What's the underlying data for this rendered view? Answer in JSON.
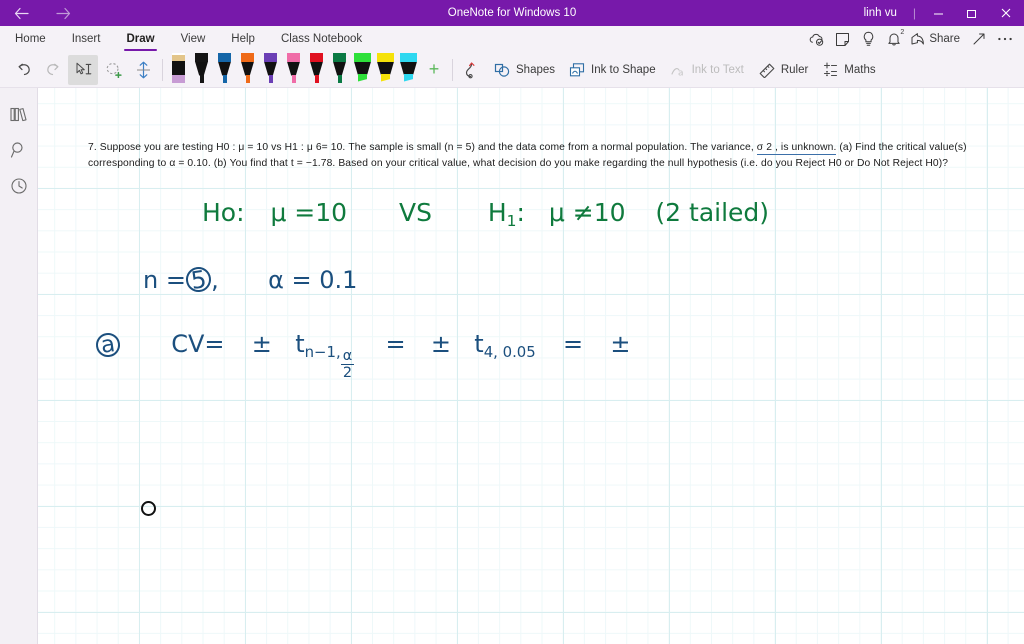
{
  "titlebar": {
    "back_icon": "back-arrow-icon",
    "forward_icon": "forward-arrow-icon",
    "title": "OneNote for Windows 10",
    "user": "linh vu",
    "separator": "|",
    "minimize": "–",
    "maximize": "☐",
    "close": "×",
    "background": "#7719aa"
  },
  "ribbon": {
    "tabs": [
      {
        "label": "Home",
        "active": false
      },
      {
        "label": "Insert",
        "active": false
      },
      {
        "label": "Draw",
        "active": true
      },
      {
        "label": "View",
        "active": false
      },
      {
        "label": "Help",
        "active": false
      },
      {
        "label": "Class Notebook",
        "active": false
      }
    ],
    "active_tab": "Draw",
    "accent": "#7719aa",
    "right_icons": [
      {
        "name": "sync-cloud-icon"
      },
      {
        "name": "sticky-note-icon"
      },
      {
        "name": "lightbulb-icon"
      },
      {
        "name": "notifications-bell-icon",
        "badge": "2"
      }
    ],
    "share_label": "Share",
    "expand_icon": "expand-diagonal-icon",
    "more_icon": "more-ellipsis-icon"
  },
  "draw_toolbar": {
    "undo_icon": "undo-icon",
    "redo_icon": "redo-icon",
    "select_type_tool": {
      "name": "select-and-type-tool",
      "selected": true
    },
    "lasso_tool": {
      "name": "lasso-select-tool",
      "selected": false
    },
    "space_tool": {
      "name": "insert-space-tool",
      "selected": false
    },
    "pens": [
      {
        "name": "pencil",
        "type": "pencil",
        "cap": "#e3c58a",
        "nib": "#c79bd4"
      },
      {
        "name": "pen-black",
        "type": "pen",
        "cap": "#151515",
        "nib": "#151515"
      },
      {
        "name": "pen-blue",
        "type": "pen",
        "cap": "#1566a8",
        "nib": "#1566a8"
      },
      {
        "name": "pen-orange",
        "type": "pen",
        "cap": "#ef6a18",
        "nib": "#ef6a18"
      },
      {
        "name": "pen-purple",
        "type": "pen",
        "cap": "#6b3fb5",
        "nib": "#6b3fb5"
      },
      {
        "name": "pen-pink",
        "type": "pen",
        "cap": "#f06ca8",
        "nib": "#f06ca8"
      },
      {
        "name": "pen-red",
        "type": "pen",
        "cap": "#e01020",
        "nib": "#e01020"
      },
      {
        "name": "pen-green",
        "type": "pen",
        "cap": "#0b7a44",
        "nib": "#0b7a44"
      },
      {
        "name": "highlighter-green",
        "type": "highlighter",
        "cap": "#2ee03a",
        "nib": "#2ee03a"
      },
      {
        "name": "highlighter-yellow",
        "type": "highlighter",
        "cap": "#f5e209",
        "nib": "#f5e209"
      },
      {
        "name": "highlighter-cyan",
        "type": "highlighter",
        "cap": "#2ed8f0",
        "nib": "#2ed8f0"
      }
    ],
    "add_pen_label": "+",
    "ink_eraser_icon": "ink-replay-icon",
    "items": [
      {
        "label": "Shapes",
        "icon": "shapes-icon",
        "disabled": false
      },
      {
        "label": "Ink to Shape",
        "icon": "ink-to-shape-icon",
        "disabled": false
      },
      {
        "label": "Ink to Text",
        "icon": "ink-to-text-icon",
        "disabled": true
      },
      {
        "label": "Ruler",
        "icon": "ruler-icon",
        "disabled": false
      },
      {
        "label": "Maths",
        "icon": "maths-icon",
        "disabled": false
      }
    ]
  },
  "rail": {
    "items": [
      {
        "name": "notebooks-icon"
      },
      {
        "name": "search-icon"
      },
      {
        "name": "recent-notes-icon"
      }
    ]
  },
  "page": {
    "problem_line1_a": "7. Suppose you are testing H0 : μ = 10 vs H1 : μ 6= 10. The sample is small (n = 5) and the data come from a normal population. The variance, ",
    "problem_underlined": "σ 2 , is unknown.",
    "problem_line1_b": " (a) Find the critical value(s)",
    "problem_line2": "corresponding to α = 0.10. (b) You find that t = −1.78. Based on your critical value, what decision do you make regarding the null hypothesis (i.e. do you Reject H0 or Do Not Reject H0)?",
    "ink": {
      "line1_h0": "Ho:",
      "line1_mu_eq": "μ =10",
      "line1_vs": "VS",
      "line1_h1": "H",
      "line1_h1_sub": "1",
      "line1_h1_colon": ":",
      "line1_mu_neq": "μ ≠10",
      "line1_tailed": "(2 tailed)",
      "line2_n": "n =",
      "line2_n_value": "5",
      "line2_comma": ",",
      "line2_alpha": "α = 0.1",
      "line3_label": "a",
      "line3_cv": "CV=",
      "line3_pm1": "±",
      "line3_t1": "t",
      "line3_t1_sub": "n−1,",
      "line3_frac_num": "α",
      "line3_frac_den": "2",
      "line3_eq1": "=",
      "line3_pm2": "±",
      "line3_t2": "t",
      "line3_t2_sub": "4, 0.05",
      "line3_eq2": "=",
      "line3_pm3": "±"
    },
    "ink_colors": {
      "green": "#0f7a3d",
      "blue": "#1b4f7e"
    },
    "cursor": "pen-cursor-circle"
  }
}
